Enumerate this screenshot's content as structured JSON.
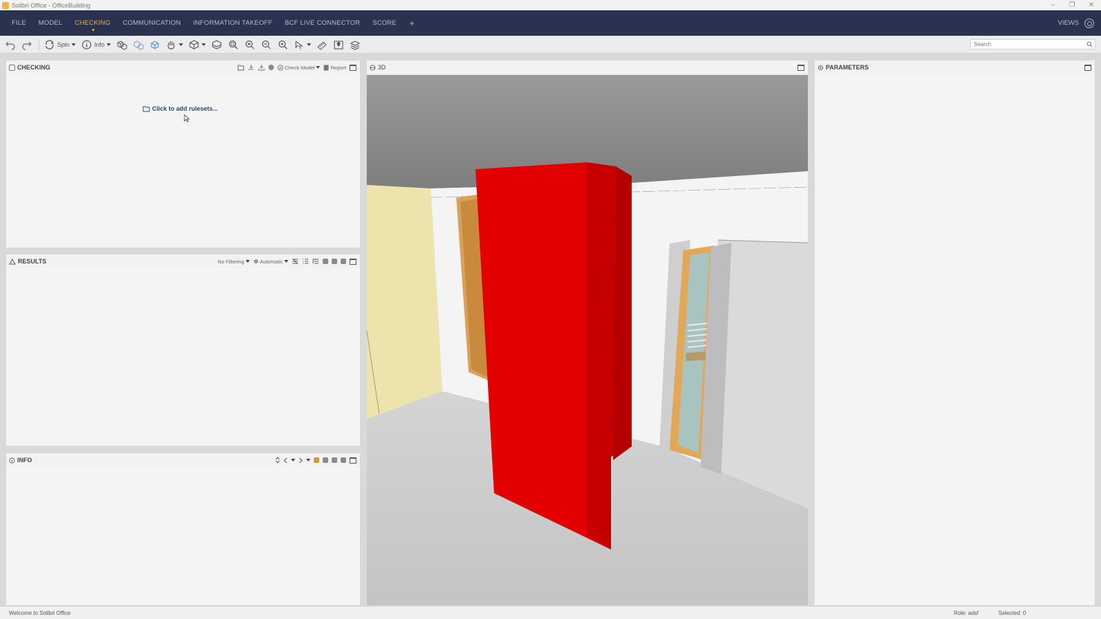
{
  "window": {
    "title": "Solibri Office - OfficeBuilding",
    "controls": [
      "–",
      "❐",
      "✕"
    ]
  },
  "menu": {
    "items": [
      "FILE",
      "MODEL",
      "CHECKING",
      "COMMUNICATION",
      "INFORMATION TAKEOFF",
      "BCF LIVE CONNECTOR",
      "SCORE"
    ],
    "active": "CHECKING",
    "add_label": "+",
    "views_label": "VIEWS"
  },
  "toolbar": {
    "spin_label": "Spin",
    "info_label": "Info",
    "search_placeholder": "Search"
  },
  "checking_panel": {
    "title": "CHECKING",
    "check_model_label": "Check Model",
    "report_label": "Report",
    "add_rulesets_label": "Click to add rulesets..."
  },
  "results_panel": {
    "title": "RESULTS",
    "filter_label": "No Filtering",
    "mode_label": "Automatic"
  },
  "info_panel": {
    "title": "INFO"
  },
  "viewport": {
    "title": "3D",
    "selected_color": "#e00000"
  },
  "parameters_panel": {
    "title": "PARAMETERS"
  },
  "status": {
    "welcome": "Welcome to Solibri Office",
    "role": "Role: adsf",
    "selected": "Selected: 0"
  },
  "colors": {
    "menubar_bg": "#2b3250",
    "accent": "#f0b429",
    "link": "#2d4a6e"
  }
}
